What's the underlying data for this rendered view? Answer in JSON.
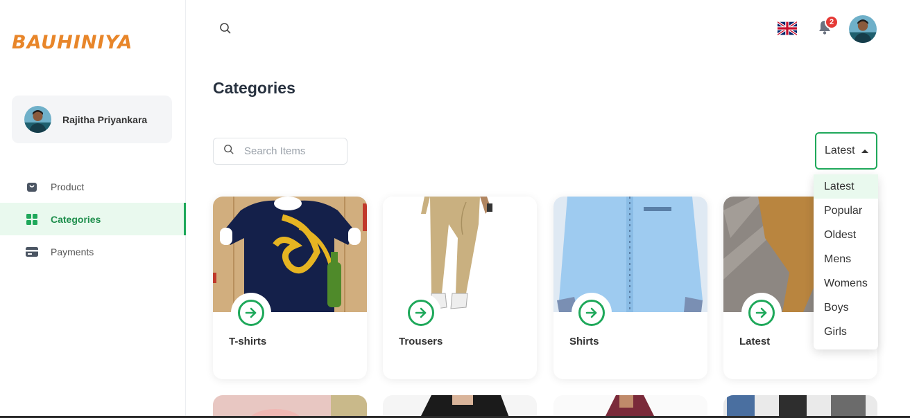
{
  "brand": {
    "logo_text": "BAUHINIYA",
    "color": "#e8862a"
  },
  "user": {
    "name": "Rajitha Priyankara"
  },
  "sidebar": {
    "items": [
      {
        "label": "Product",
        "icon": "bag-icon",
        "active": false
      },
      {
        "label": "Categories",
        "icon": "grid-icon",
        "active": true
      },
      {
        "label": "Payments",
        "icon": "card-icon",
        "active": false
      }
    ]
  },
  "topbar": {
    "notification_count": "2",
    "language": "English (UK flag)"
  },
  "page": {
    "title": "Categories"
  },
  "search": {
    "placeholder": "Search Items",
    "value": ""
  },
  "sort": {
    "selected": "Latest",
    "options": [
      "Latest",
      "Popular",
      "Oldest",
      "Mens",
      "Womens",
      "Boys",
      "Girls"
    ]
  },
  "categories": [
    {
      "label": "T-shirts"
    },
    {
      "label": "Trousers"
    },
    {
      "label": "Shirts"
    },
    {
      "label": "Latest"
    }
  ],
  "colors": {
    "accent": "#1ea85a",
    "active_bg": "#e9f9ee",
    "badge": "#e53935"
  }
}
